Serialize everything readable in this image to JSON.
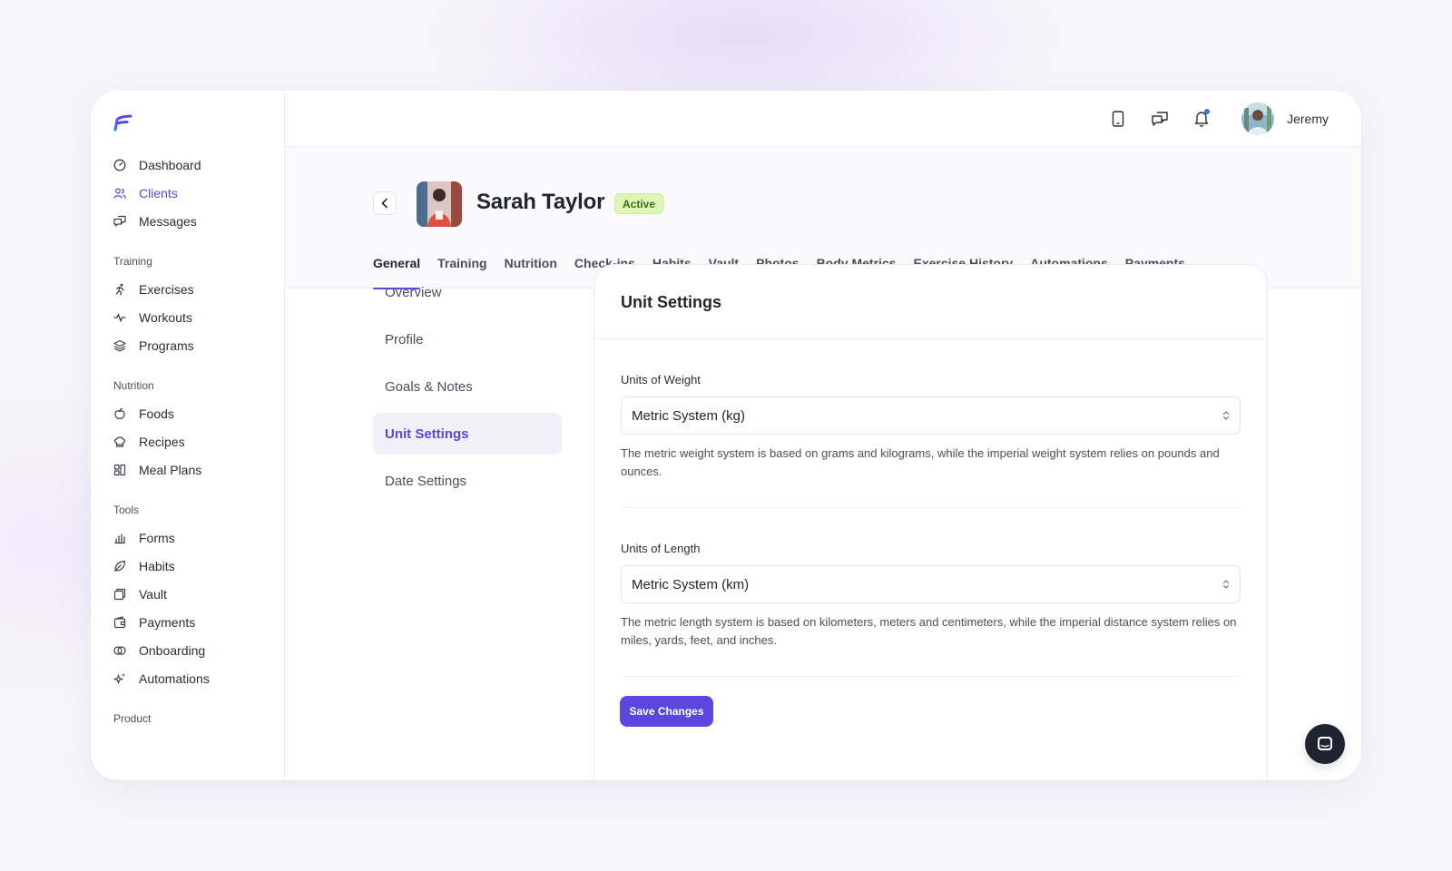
{
  "brand": {
    "accent": "#5b47e0",
    "logo_icon": "brand-logo-icon"
  },
  "sidebar": {
    "top_items": [
      {
        "label": "Dashboard",
        "icon": "dashboard-icon"
      },
      {
        "label": "Clients",
        "icon": "users-icon",
        "active": true
      },
      {
        "label": "Messages",
        "icon": "messages-icon"
      }
    ],
    "sections": [
      {
        "title": "Training",
        "items": [
          {
            "label": "Exercises",
            "icon": "runner-icon"
          },
          {
            "label": "Workouts",
            "icon": "pulse-icon"
          },
          {
            "label": "Programs",
            "icon": "layers-icon"
          }
        ]
      },
      {
        "title": "Nutrition",
        "items": [
          {
            "label": "Foods",
            "icon": "apple-icon"
          },
          {
            "label": "Recipes",
            "icon": "chef-hat-icon"
          },
          {
            "label": "Meal Plans",
            "icon": "meal-plan-icon"
          }
        ]
      },
      {
        "title": "Tools",
        "items": [
          {
            "label": "Forms",
            "icon": "form-icon"
          },
          {
            "label": "Habits",
            "icon": "leaf-icon"
          },
          {
            "label": "Vault",
            "icon": "folder-icon"
          },
          {
            "label": "Payments",
            "icon": "wallet-icon"
          },
          {
            "label": "Onboarding",
            "icon": "rings-icon"
          },
          {
            "label": "Automations",
            "icon": "sparkle-icon"
          }
        ]
      },
      {
        "title": "Product",
        "items": []
      }
    ]
  },
  "topbar": {
    "user_name": "Jeremy",
    "has_notification": true
  },
  "client": {
    "name": "Sarah Taylor",
    "status": "Active",
    "tabs": [
      "General",
      "Training",
      "Nutrition",
      "Check-ins",
      "Habits",
      "Vault",
      "Photos",
      "Body Metrics",
      "Exercise History",
      "Automations",
      "Payments"
    ],
    "active_tab": "General"
  },
  "settings_nav": {
    "items": [
      "Overview",
      "Profile",
      "Goals & Notes",
      "Unit Settings",
      "Date Settings"
    ],
    "active": "Unit Settings"
  },
  "unit_settings": {
    "title": "Unit Settings",
    "weight": {
      "label": "Units of Weight",
      "value": "Metric System (kg)",
      "help": "The metric weight system is based on grams and kilograms, while the imperial weight system relies on pounds and ounces."
    },
    "length": {
      "label": "Units of Length",
      "value": "Metric System (km)",
      "help": "The metric length system is based on kilometers, meters and centimeters, while the imperial distance system relies on miles, yards, feet, and inches."
    },
    "save_label": "Save Changes"
  }
}
